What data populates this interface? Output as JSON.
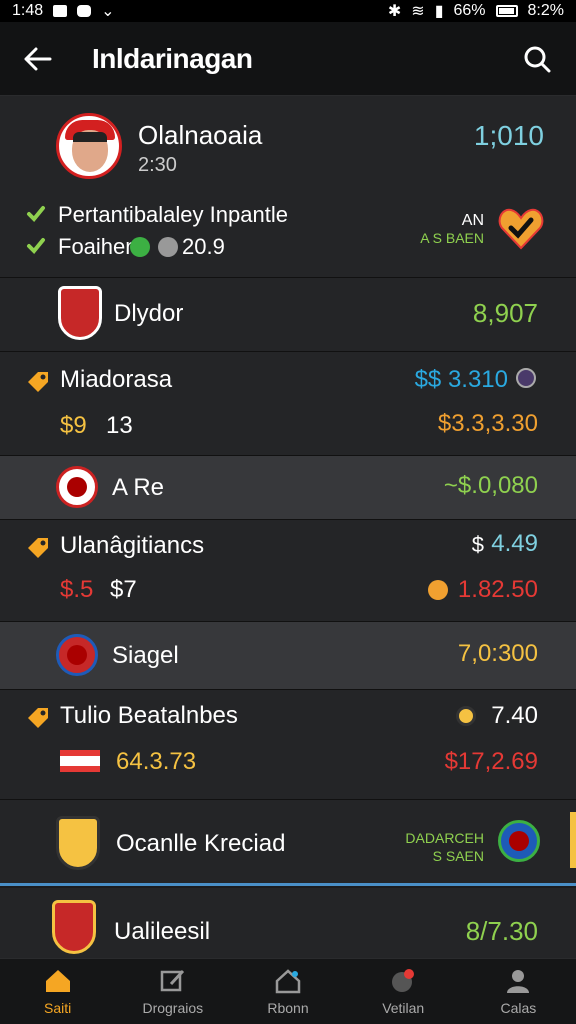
{
  "status": {
    "time": "1:48",
    "battery_text": "66%",
    "clock_right": "8:2%"
  },
  "header": {
    "title": "Inldarinagan"
  },
  "profile": {
    "name": "Olalnaoaia",
    "time": "2:30",
    "value": "1;010",
    "line1": "Pertantibalaley Inpantle",
    "line2_text": "Foaihen",
    "line2_value": "20.9",
    "tag_top": "AN",
    "tag_bottom": "A S BAEN"
  },
  "rows": [
    {
      "name": "Dlydor",
      "value": "8,907"
    },
    {
      "name": "Miadorasa",
      "value": "$$ 3.310",
      "sub_left": "$9",
      "sub_mid": "13",
      "sub_right": "$3.3,3.30"
    },
    {
      "name": "A Re",
      "value": "~$.0,080"
    },
    {
      "name": "Ulanâgitiancs",
      "value_prefix": "$",
      "value": "4.49",
      "sub_left": "$.5",
      "sub_mid": "$7",
      "sub_right": "1.82.50"
    },
    {
      "name": "Siagel",
      "value": "7,0:300"
    },
    {
      "name": "Tulio Beatalnbes",
      "value": "7.40",
      "sub_mid": "64.3.73",
      "sub_right": "$17,2.69"
    },
    {
      "name": "Ocanlle Kreciad",
      "tag_top": "DADARCEH",
      "tag_bottom": "S SAEN"
    },
    {
      "name": "Ualileesil",
      "value": "8/7.30"
    }
  ],
  "nav": [
    {
      "label": "Saiti",
      "icon": "home-icon",
      "active": true
    },
    {
      "label": "Drograios",
      "icon": "edit-icon",
      "active": false
    },
    {
      "label": "Rbonn",
      "icon": "house-icon",
      "active": false
    },
    {
      "label": "Vetilan",
      "icon": "alert-icon",
      "active": false
    },
    {
      "label": "Calas",
      "icon": "user-icon",
      "active": false
    }
  ],
  "colors": {
    "green": "#8fd14f",
    "yellow": "#f5c242",
    "orange": "#f0a030",
    "red": "#e53935",
    "cyan": "#7fd0e0",
    "blue": "#2aa9e0"
  }
}
